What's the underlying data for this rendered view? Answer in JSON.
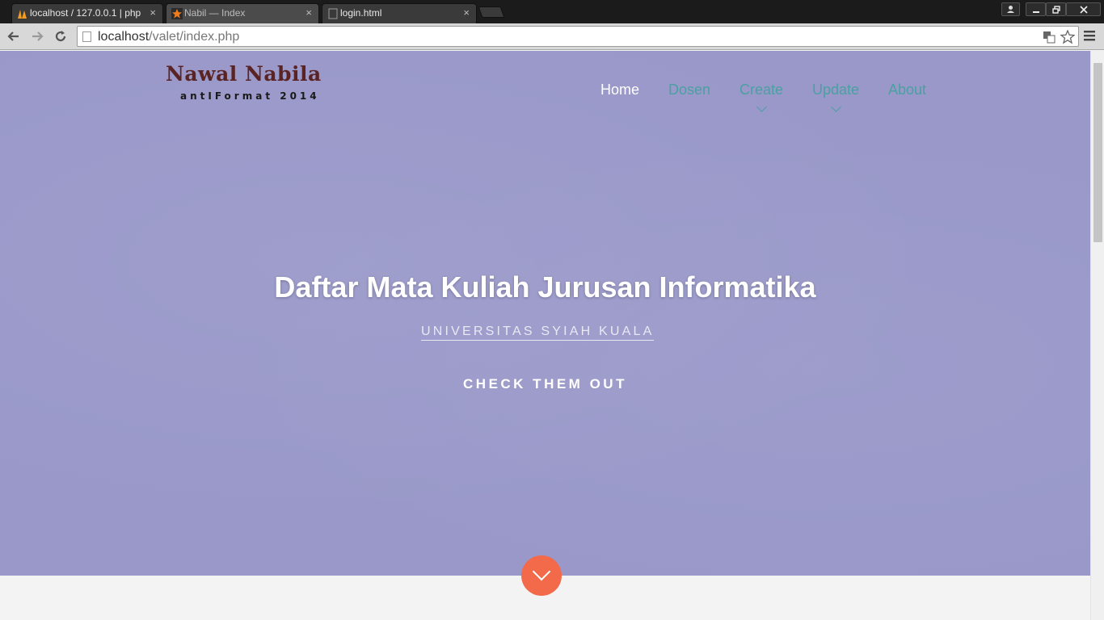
{
  "browser": {
    "tabs": [
      {
        "title": "localhost / 127.0.0.1 | php",
        "icon": "phpmyadmin-icon"
      },
      {
        "title": "Nabil — Index",
        "icon": "star-icon"
      },
      {
        "title": "login.html",
        "icon": "page-icon"
      }
    ],
    "tab_close_glyph": "×",
    "url_host": "localhost",
    "url_path": "/valet/index.php"
  },
  "site": {
    "logo_title": "Nawal Nabila",
    "logo_subtitle": "antIFormat 2014"
  },
  "nav": {
    "items": [
      {
        "label": "Home",
        "active": true,
        "has_dropdown": false
      },
      {
        "label": "Dosen",
        "active": false,
        "has_dropdown": false
      },
      {
        "label": "Create",
        "active": false,
        "has_dropdown": true
      },
      {
        "label": "Update",
        "active": false,
        "has_dropdown": true
      },
      {
        "label": "About",
        "active": false,
        "has_dropdown": false
      }
    ]
  },
  "hero": {
    "title": "Daftar Mata Kuliah Jurusan Informatika",
    "subtitle": "UNIVERSITAS SYIAH KUALA",
    "cta": "CHECK THEM OUT"
  },
  "colors": {
    "hero_bg": "#9998c9",
    "nav_link": "#4aa0a2",
    "logo": "#5a2324",
    "scroll_button": "#f26a4a"
  }
}
